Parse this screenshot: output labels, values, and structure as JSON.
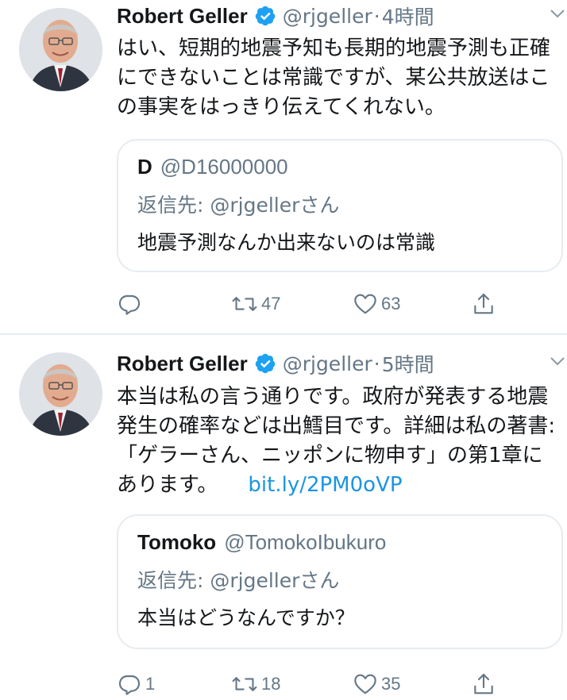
{
  "tweets": [
    {
      "author_name": "Robert Geller",
      "handle": "@rjgeller",
      "separator": "·",
      "time": "4時間",
      "text": "はい、短期的地震予知も長期的地震予測も正確にできないことは常識ですが、某公共放送はこの事実をはっきり伝えてくれない。",
      "link": "",
      "quote": {
        "author_name": "D",
        "handle": "@D16000000",
        "reply_to": "返信先: @rjgellerさん",
        "text": "地震予測なんか出来ないのは常識"
      },
      "actions": {
        "reply_count": "",
        "retweet_count": "47",
        "like_count": "63"
      }
    },
    {
      "author_name": "Robert Geller",
      "handle": "@rjgeller",
      "separator": "·",
      "time": "5時間",
      "text": "本当は私の言う通りです。政府が発表する地震発生の確率などは出鱈目です。詳細は私の著書: 「ゲラーさん、ニッポンに物申す」の第1章にあります。",
      "link": "bit.ly/2PM0oVP",
      "quote": {
        "author_name": "Tomoko",
        "handle": "@TomokoIbukuro",
        "reply_to": "返信先: @rjgellerさん",
        "text": "本当はどうなんですか？"
      },
      "actions": {
        "reply_count": "1",
        "retweet_count": "18",
        "like_count": "35"
      }
    }
  ],
  "icons": {
    "verified": "verified-badge-icon",
    "caret": "chevron-down-icon",
    "reply": "reply-icon",
    "retweet": "retweet-icon",
    "like": "heart-icon",
    "share": "share-icon"
  },
  "colors": {
    "verified_blue": "#1da1f2",
    "link_blue": "#1b95e0",
    "secondary_text": "#657786",
    "primary_text": "#14171a",
    "border": "#e6ecf0"
  }
}
